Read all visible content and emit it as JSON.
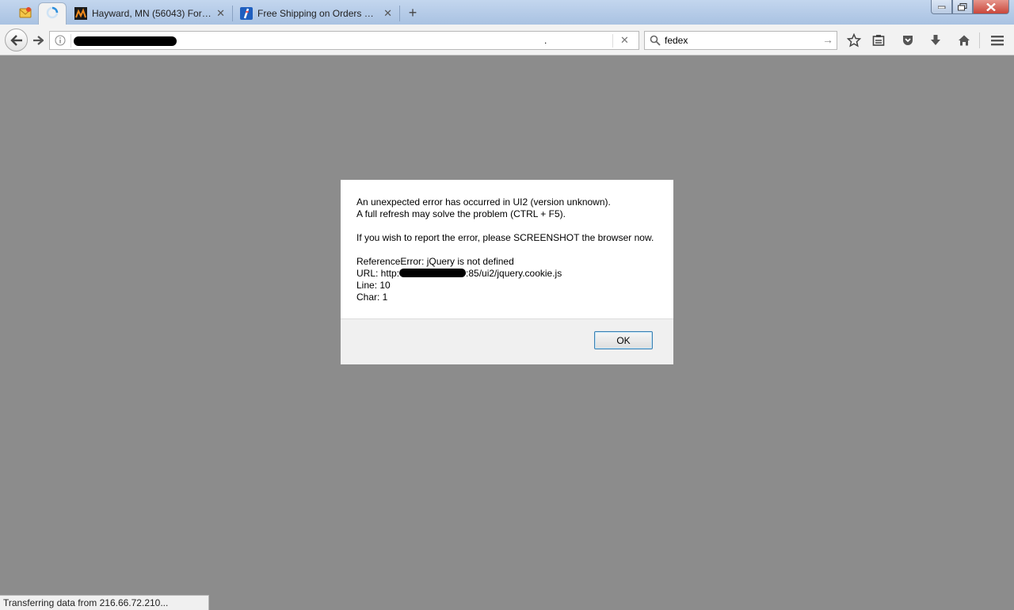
{
  "tabs": [
    {
      "title": "Hayward, MN (56043) Fore...",
      "active": false
    },
    {
      "title": "Free Shipping on Orders O...",
      "active": false
    }
  ],
  "pinned_tabs": [
    "mail-icon",
    "loading-spinner-icon"
  ],
  "new_tab_label": "+",
  "navbar": {
    "url_value": ".",
    "search_value": "fedex",
    "url_clear": "✕",
    "search_go": "→"
  },
  "dialog": {
    "lines": [
      "An unexpected error has occurred in UI2 (version unknown).",
      "A full refresh may solve the problem (CTRL + F5).",
      "",
      "If you wish to report the error, please SCREENSHOT the browser now.",
      "",
      "ReferenceError: jQuery is not defined"
    ],
    "url_prefix": "URL: http:",
    "url_suffix": ":85/ui2/jquery.cookie.js",
    "line_text": "Line: 10",
    "char_text": "Char: 1",
    "ok_label": "OK"
  },
  "status_text": "Transferring data from 216.66.72.210...",
  "colors": {
    "page_bg": "#8c8c8c",
    "titlebar": "#b6cce8",
    "close_button": "#c9473b"
  }
}
